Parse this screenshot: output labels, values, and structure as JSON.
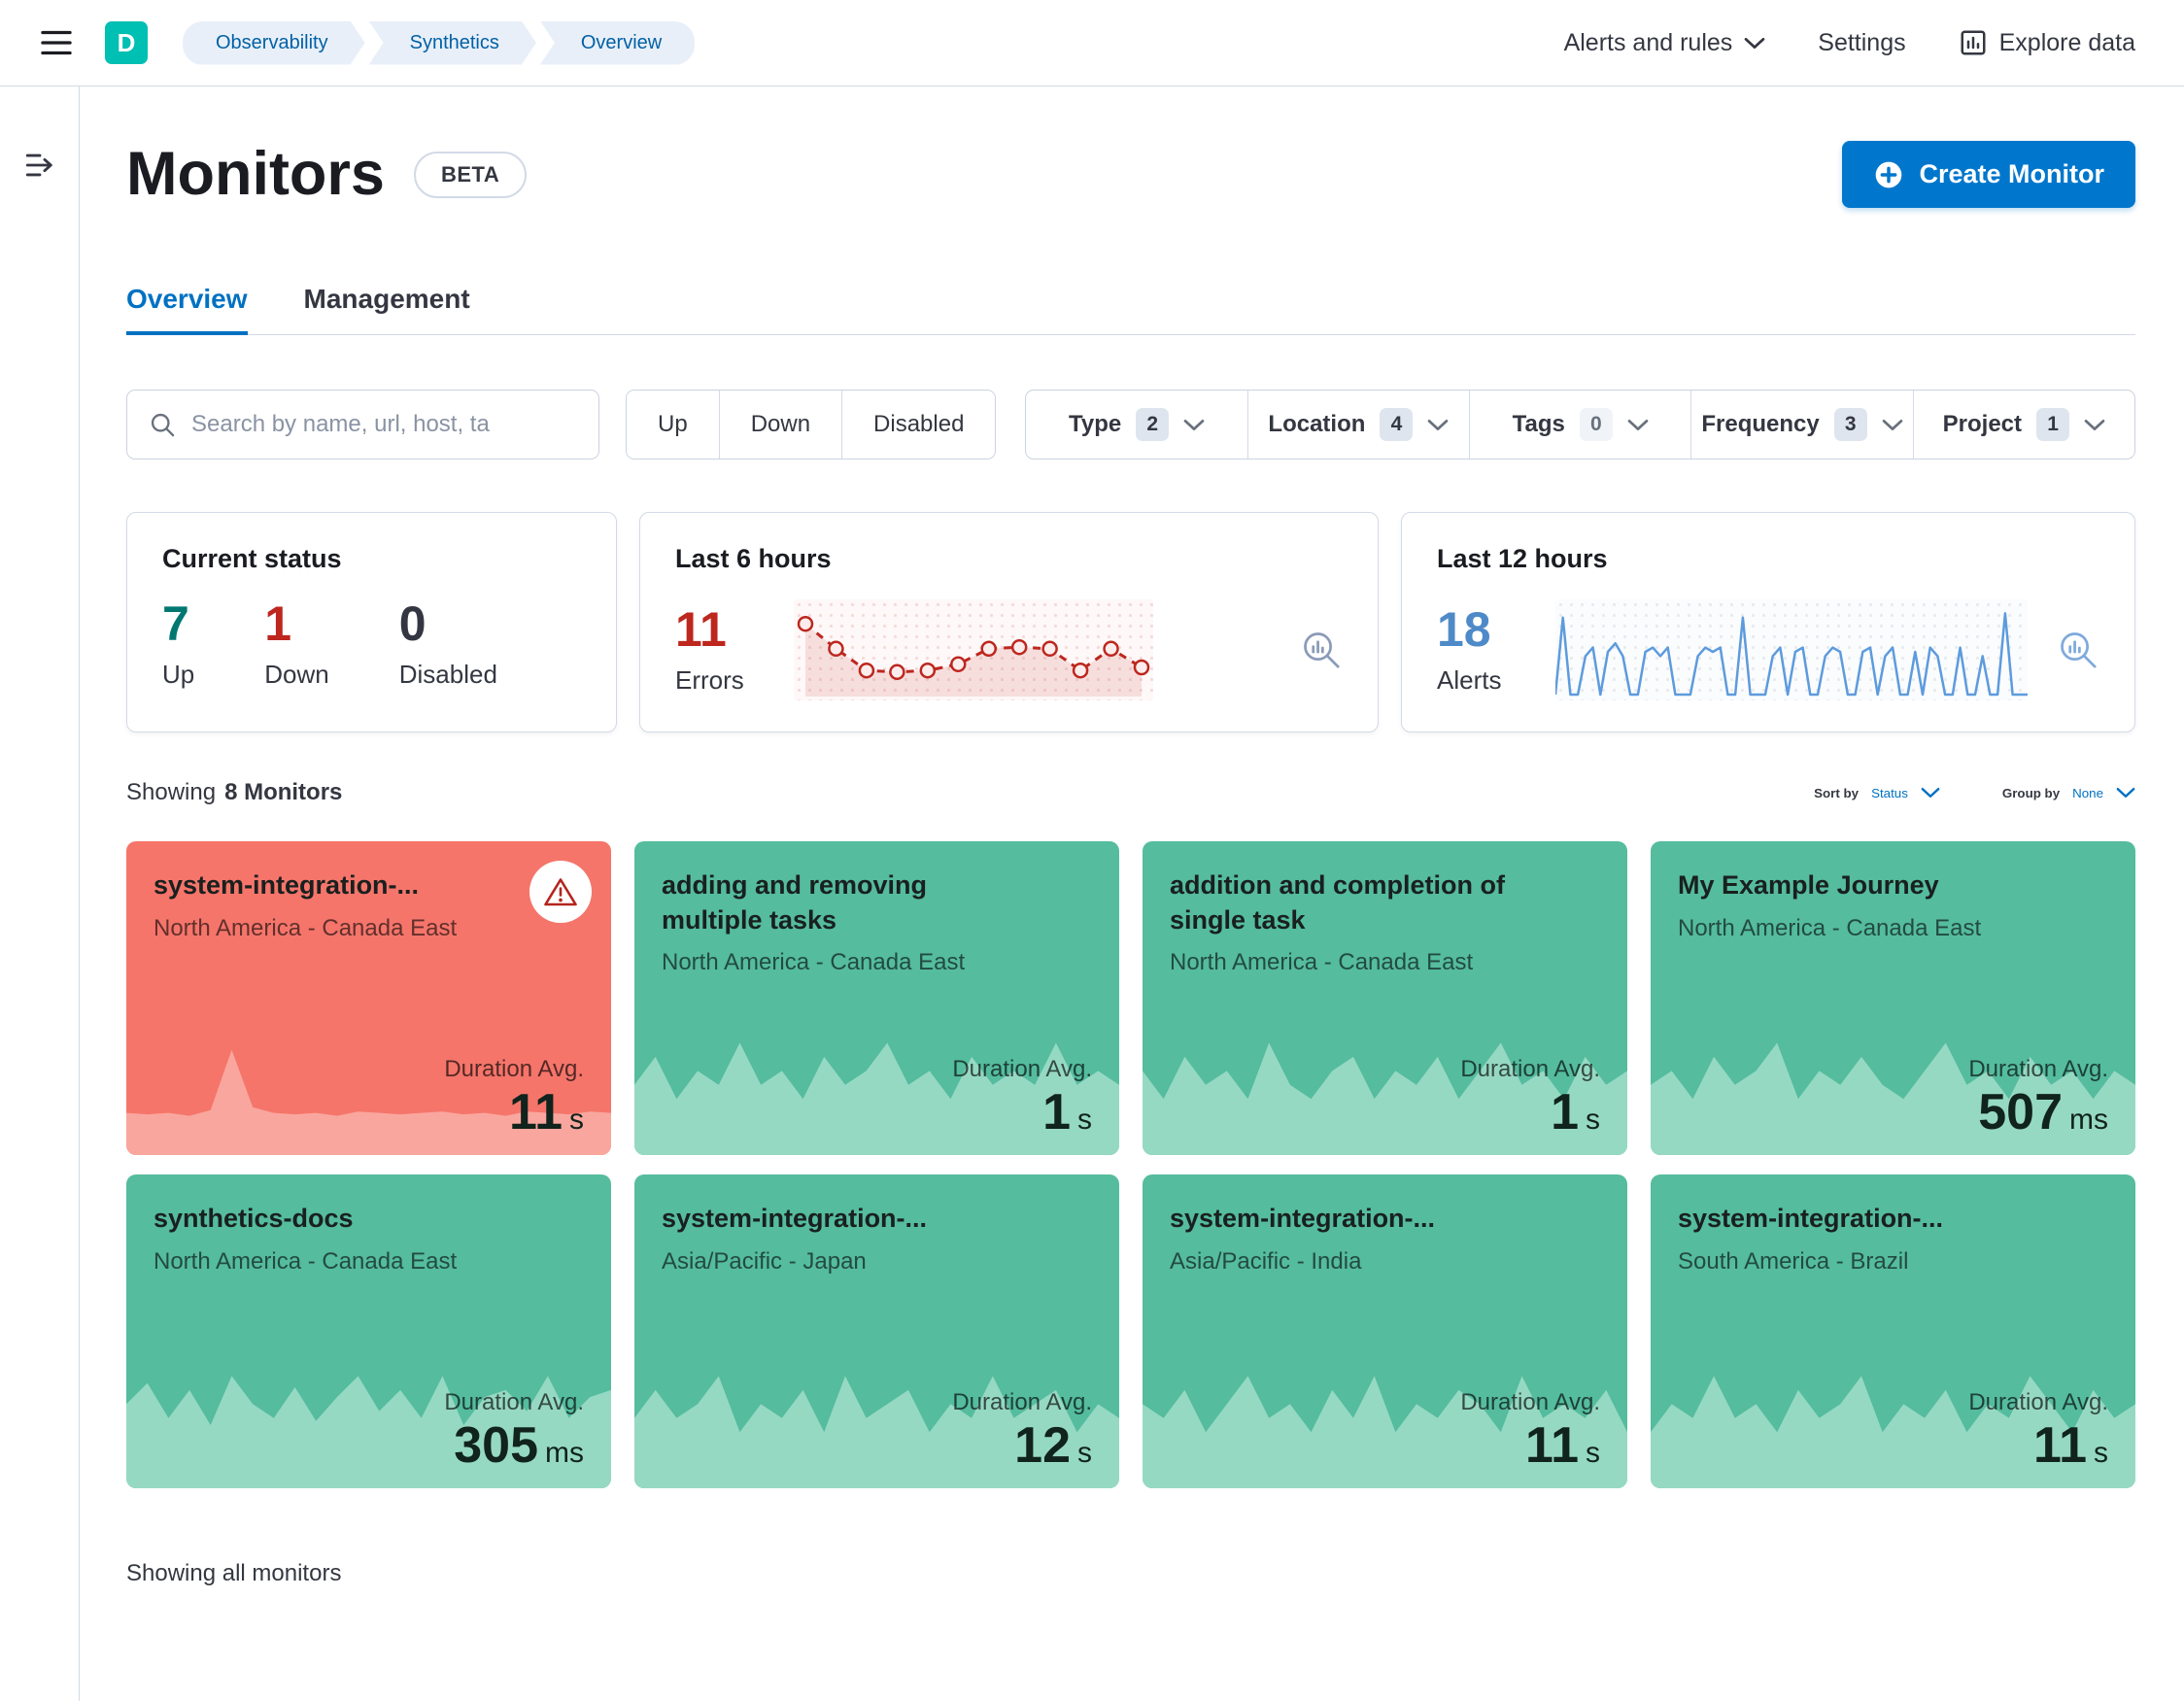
{
  "topbar": {
    "space_initial": "D",
    "breadcrumbs": [
      "Observability",
      "Synthetics",
      "Overview"
    ],
    "alerts_label": "Alerts and rules",
    "settings_label": "Settings",
    "explore_label": "Explore data"
  },
  "page": {
    "title": "Monitors",
    "beta_badge": "BETA",
    "create_button": "Create Monitor",
    "tabs": [
      {
        "label": "Overview",
        "active": true
      },
      {
        "label": "Management",
        "active": false
      }
    ],
    "duration_label": "Duration Avg.",
    "footer": "Showing all monitors"
  },
  "filters": {
    "search_placeholder": "Search by name, url, host, ta",
    "status_buttons": [
      "Up",
      "Down",
      "Disabled"
    ],
    "dropdowns": [
      {
        "label": "Type",
        "count": "2"
      },
      {
        "label": "Location",
        "count": "4"
      },
      {
        "label": "Tags",
        "count": "0"
      },
      {
        "label": "Frequency",
        "count": "3"
      },
      {
        "label": "Project",
        "count": "1"
      }
    ]
  },
  "stats": {
    "current_status": {
      "title": "Current status",
      "items": [
        {
          "value": "7",
          "label": "Up",
          "color": "#007871"
        },
        {
          "value": "1",
          "label": "Down",
          "color": "#BD271E"
        },
        {
          "value": "0",
          "label": "Disabled",
          "color": "#343741"
        }
      ]
    },
    "errors": {
      "title": "Last 6 hours",
      "value": "11",
      "label": "Errors"
    },
    "alerts": {
      "title": "Last 12 hours",
      "value": "18",
      "label": "Alerts"
    }
  },
  "list_header": {
    "showing_prefix": "Showing",
    "count": "8 Monitors",
    "sort_label": "Sort by",
    "sort_value": "Status",
    "group_label": "Group by",
    "group_value": "None"
  },
  "chart_data": [
    {
      "type": "line",
      "name": "errors-last-6-hours",
      "title": "Last 6 hours",
      "x": [
        0,
        1,
        2,
        3,
        4,
        5,
        6,
        7,
        8,
        9,
        10,
        11
      ],
      "series": [
        {
          "name": "Errors",
          "values": [
            8.6,
            5.4,
            2.6,
            2.4,
            2.6,
            3.4,
            5.4,
            5.6,
            5.4,
            2.6,
            5.4,
            3.0
          ]
        }
      ],
      "ylim": [
        0,
        10
      ],
      "style": "dashed-with-open-markers",
      "color": "#BD271E",
      "fill": "rgba(189,39,30,0.12)",
      "grid": false,
      "legend": "none"
    },
    {
      "type": "area",
      "name": "alerts-last-12-hours",
      "title": "Last 12 hours",
      "values": [
        0,
        9,
        0,
        0,
        4.5,
        5.5,
        0,
        5,
        6,
        4.5,
        0,
        0,
        5,
        5.5,
        4.5,
        5.5,
        0,
        0,
        0,
        4.5,
        5.5,
        5,
        5.5,
        0,
        0,
        9,
        0,
        0,
        0,
        4.5,
        5.5,
        0,
        5,
        5.5,
        0,
        0,
        4.5,
        5.5,
        5,
        0,
        0,
        5,
        5.5,
        0,
        4.5,
        5.5,
        0,
        0,
        5,
        0,
        5.5,
        4.5,
        0,
        0,
        5.5,
        0,
        0,
        4.5,
        0,
        0,
        9.5,
        0,
        0,
        0
      ],
      "ylim": [
        0,
        10
      ],
      "style": "spiky-line",
      "color": "#5D9BDD",
      "grid": false,
      "legend": "none"
    }
  ],
  "monitors": [
    {
      "name": "system-integration-...",
      "location": "North America - Canada East",
      "duration_value": "11",
      "duration_unit": "s",
      "status": "down",
      "spark": [
        3,
        2.9,
        3,
        2.8,
        3.2,
        7.5,
        3.4,
        3,
        2.9,
        3,
        2.8,
        3.1,
        3,
        2.9,
        3,
        3.1,
        2.9,
        3,
        2.8,
        3.1,
        3,
        2.9,
        3.1,
        3
      ]
    },
    {
      "name": "adding and removing multiple tasks",
      "location": "North America - Canada East",
      "duration_value": "1",
      "duration_unit": "s",
      "status": "up",
      "spark": [
        5,
        7,
        4,
        6,
        5,
        8,
        5,
        6,
        4,
        7,
        5,
        6,
        8,
        5,
        6,
        4,
        7,
        5,
        6,
        5,
        8,
        5,
        6,
        5
      ]
    },
    {
      "name": "addition and completion of single task",
      "location": "North America - Canada East",
      "duration_value": "1",
      "duration_unit": "s",
      "status": "up",
      "spark": [
        6,
        4,
        7,
        5,
        6,
        4,
        8,
        5,
        4,
        6,
        7,
        4,
        6,
        5,
        7,
        4,
        6,
        8,
        5,
        6,
        4,
        7,
        5,
        6
      ]
    },
    {
      "name": "My Example Journey",
      "location": "North America - Canada East",
      "duration_value": "507",
      "duration_unit": "ms",
      "status": "up",
      "spark": [
        5,
        6,
        4,
        7,
        5,
        6,
        8,
        4,
        6,
        5,
        7,
        5,
        4,
        6,
        8,
        5,
        6,
        4,
        7,
        5,
        6,
        4,
        6,
        5
      ]
    },
    {
      "name": "synthetics-docs",
      "location": "North America - Canada East",
      "duration_value": "305",
      "duration_unit": "ms",
      "status": "up",
      "spark": [
        6,
        7.5,
        5,
        7,
        4.5,
        8,
        6,
        5,
        7.2,
        4.8,
        6.5,
        8,
        5.5,
        7,
        5,
        8,
        4.5,
        6.5,
        7,
        5.5,
        8,
        5,
        6.5,
        7
      ]
    },
    {
      "name": "system-integration-...",
      "location": "Asia/Pacific - Japan",
      "duration_value": "12",
      "duration_unit": "s",
      "status": "up",
      "spark": [
        5,
        7,
        5,
        6,
        8,
        4,
        6,
        5,
        7,
        4,
        8,
        5,
        6,
        7,
        4,
        6,
        5,
        8,
        5,
        6,
        7,
        4,
        6,
        5
      ]
    },
    {
      "name": "system-integration-...",
      "location": "Asia/Pacific - India",
      "duration_value": "11",
      "duration_unit": "s",
      "status": "up",
      "spark": [
        6,
        5,
        7,
        4,
        6,
        8,
        5,
        6,
        4,
        7,
        5,
        8,
        4,
        6,
        5,
        7,
        6,
        4,
        8,
        5,
        6,
        5,
        7,
        4
      ]
    },
    {
      "name": "system-integration-...",
      "location": "South America - Brazil",
      "duration_value": "11",
      "duration_unit": "s",
      "status": "up",
      "spark": [
        4,
        6,
        5,
        8,
        5,
        6,
        4,
        7,
        5,
        6,
        8,
        4,
        6,
        5,
        7,
        4,
        6,
        5,
        8,
        6,
        4,
        7,
        5,
        6
      ]
    }
  ],
  "colors": {
    "primary": "#0077CC",
    "success": "#007871",
    "danger": "#BD271E",
    "alerts_blue": "#4E8AC8",
    "card_up": "#55BC9E",
    "card_up_spark": "#96D9C3",
    "card_down": "#F5756B",
    "card_down_spark": "#F9A79E",
    "avatar_teal": "#00BFB3"
  },
  "icons": {
    "menu": "hamburger-icon",
    "search": "magnifier-icon",
    "inspect": "magnifier-chart-icon",
    "chevron": "chevron-down-icon",
    "create": "plus-in-circle-icon",
    "warning": "warning-triangle-icon",
    "explore": "bar-chart-icon",
    "rail": "expand-menu-icon"
  }
}
